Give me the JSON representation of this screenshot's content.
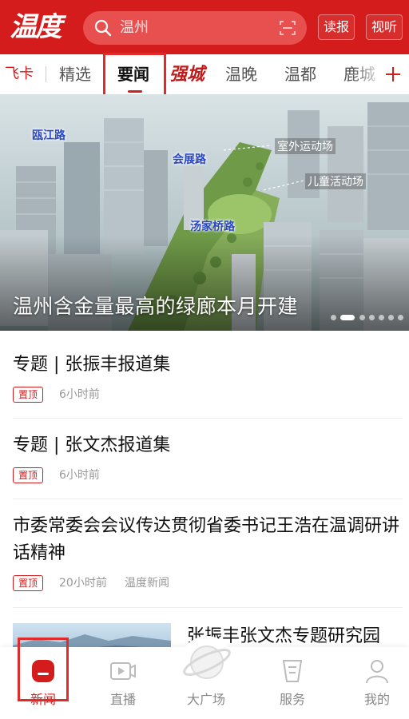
{
  "app": {
    "logo_text": "温度"
  },
  "search": {
    "placeholder": "温州"
  },
  "header_buttons": {
    "read": "读报",
    "watch": "视听"
  },
  "tabs": [
    "飞卡",
    "精选",
    "要闻",
    "强城",
    "温晚",
    "温都",
    "鹿城"
  ],
  "active_tab": "要闻",
  "hero": {
    "title": "温州含金量最高的绿廊本月开建",
    "map_labels": {
      "ojiang_road": "瓯江路",
      "huizhan_road": "会展路",
      "tangjiaqiao_road": "汤家桥路",
      "outdoor_field": "室外运动场",
      "kids_field": "儿童活动场"
    },
    "slides_count": 7,
    "active_slide": 2
  },
  "news": [
    {
      "title": "专题 | 张振丰报道集",
      "badge": "置顶",
      "time": "6小时前",
      "source": ""
    },
    {
      "title": "专题 | 张文杰报道集",
      "badge": "置顶",
      "time": "6小时前",
      "source": ""
    },
    {
      "title": "市委常委会会议传达贯彻省委书记王浩在温调研讲话精神",
      "badge": "置顶",
      "time": "20小时前",
      "source": "温度新闻"
    },
    {
      "title": "张振丰张文杰专题研究园",
      "badge": "",
      "time": "",
      "source": ""
    }
  ],
  "bottom_nav": [
    "新闻",
    "直播",
    "大广场",
    "服务",
    "我的"
  ],
  "colors": {
    "brand_red": "#d41c1c",
    "highlight_box": "#e12a2a"
  }
}
